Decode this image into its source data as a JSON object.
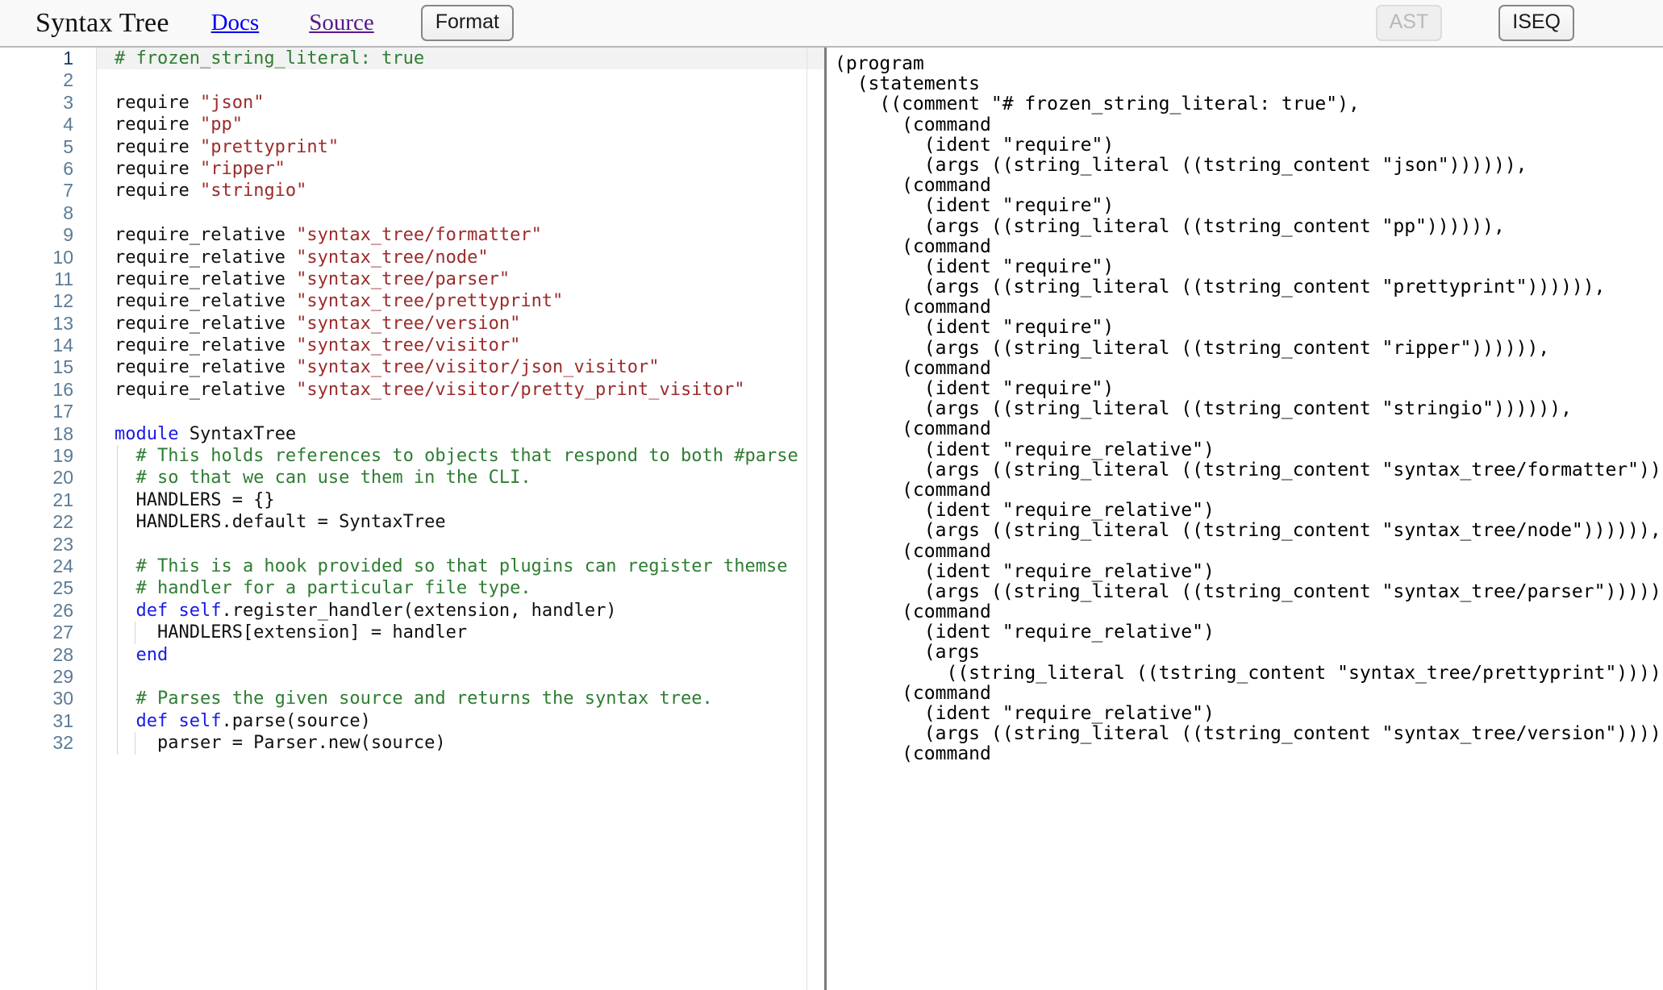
{
  "header": {
    "brand": "Syntax Tree",
    "docs_label": "Docs",
    "source_label": "Source",
    "format_label": "Format",
    "ast_label": "AST",
    "iseq_label": "ISEQ",
    "colors": {
      "link": "#0000ee",
      "visited_link": "#551a8b",
      "header_bg": "#f9f9f9",
      "button_border": "#868686",
      "disabled_text": "#b9b9b9"
    }
  },
  "editor": {
    "language": "ruby",
    "active_line": 1,
    "first_visible_line": 1,
    "last_visible_line": 32,
    "colors": {
      "comment": "#2e7d32",
      "string": "#9c2b2b",
      "keyword": "#1a1ae6",
      "text": "#111111",
      "line_number": "#5b7a95",
      "active_line_number": "#16385e",
      "active_line_bg": "#f2f2f2"
    },
    "lines": [
      {
        "n": 1,
        "indent": 0,
        "tokens": [
          {
            "t": "com",
            "v": "# frozen_string_literal: true"
          }
        ]
      },
      {
        "n": 2,
        "indent": 0,
        "tokens": []
      },
      {
        "n": 3,
        "indent": 0,
        "tokens": [
          {
            "t": "txt",
            "v": "require "
          },
          {
            "t": "str",
            "v": "\"json\""
          }
        ]
      },
      {
        "n": 4,
        "indent": 0,
        "tokens": [
          {
            "t": "txt",
            "v": "require "
          },
          {
            "t": "str",
            "v": "\"pp\""
          }
        ]
      },
      {
        "n": 5,
        "indent": 0,
        "tokens": [
          {
            "t": "txt",
            "v": "require "
          },
          {
            "t": "str",
            "v": "\"prettyprint\""
          }
        ]
      },
      {
        "n": 6,
        "indent": 0,
        "tokens": [
          {
            "t": "txt",
            "v": "require "
          },
          {
            "t": "str",
            "v": "\"ripper\""
          }
        ]
      },
      {
        "n": 7,
        "indent": 0,
        "tokens": [
          {
            "t": "txt",
            "v": "require "
          },
          {
            "t": "str",
            "v": "\"stringio\""
          }
        ]
      },
      {
        "n": 8,
        "indent": 0,
        "tokens": []
      },
      {
        "n": 9,
        "indent": 0,
        "tokens": [
          {
            "t": "txt",
            "v": "require_relative "
          },
          {
            "t": "str",
            "v": "\"syntax_tree/formatter\""
          }
        ]
      },
      {
        "n": 10,
        "indent": 0,
        "tokens": [
          {
            "t": "txt",
            "v": "require_relative "
          },
          {
            "t": "str",
            "v": "\"syntax_tree/node\""
          }
        ]
      },
      {
        "n": 11,
        "indent": 0,
        "tokens": [
          {
            "t": "txt",
            "v": "require_relative "
          },
          {
            "t": "str",
            "v": "\"syntax_tree/parser\""
          }
        ]
      },
      {
        "n": 12,
        "indent": 0,
        "tokens": [
          {
            "t": "txt",
            "v": "require_relative "
          },
          {
            "t": "str",
            "v": "\"syntax_tree/prettyprint\""
          }
        ]
      },
      {
        "n": 13,
        "indent": 0,
        "tokens": [
          {
            "t": "txt",
            "v": "require_relative "
          },
          {
            "t": "str",
            "v": "\"syntax_tree/version\""
          }
        ]
      },
      {
        "n": 14,
        "indent": 0,
        "tokens": [
          {
            "t": "txt",
            "v": "require_relative "
          },
          {
            "t": "str",
            "v": "\"syntax_tree/visitor\""
          }
        ]
      },
      {
        "n": 15,
        "indent": 0,
        "tokens": [
          {
            "t": "txt",
            "v": "require_relative "
          },
          {
            "t": "str",
            "v": "\"syntax_tree/visitor/json_visitor\""
          }
        ]
      },
      {
        "n": 16,
        "indent": 0,
        "tokens": [
          {
            "t": "txt",
            "v": "require_relative "
          },
          {
            "t": "str",
            "v": "\"syntax_tree/visitor/pretty_print_visitor\""
          }
        ]
      },
      {
        "n": 17,
        "indent": 0,
        "tokens": []
      },
      {
        "n": 18,
        "indent": 0,
        "tokens": [
          {
            "t": "kw",
            "v": "module"
          },
          {
            "t": "txt",
            "v": " SyntaxTree"
          }
        ]
      },
      {
        "n": 19,
        "indent": 1,
        "tokens": [
          {
            "t": "com",
            "v": "  # This holds references to objects that respond to both #parse"
          }
        ]
      },
      {
        "n": 20,
        "indent": 1,
        "tokens": [
          {
            "t": "com",
            "v": "  # so that we can use them in the CLI."
          }
        ]
      },
      {
        "n": 21,
        "indent": 1,
        "tokens": [
          {
            "t": "txt",
            "v": "  HANDLERS = {}"
          }
        ]
      },
      {
        "n": 22,
        "indent": 1,
        "tokens": [
          {
            "t": "txt",
            "v": "  HANDLERS.default = SyntaxTree"
          }
        ]
      },
      {
        "n": 23,
        "indent": 1,
        "tokens": []
      },
      {
        "n": 24,
        "indent": 1,
        "tokens": [
          {
            "t": "com",
            "v": "  # This is a hook provided so that plugins can register themse"
          }
        ]
      },
      {
        "n": 25,
        "indent": 1,
        "tokens": [
          {
            "t": "com",
            "v": "  # handler for a particular file type."
          }
        ]
      },
      {
        "n": 26,
        "indent": 1,
        "tokens": [
          {
            "t": "txt",
            "v": "  "
          },
          {
            "t": "kw",
            "v": "def"
          },
          {
            "t": "txt",
            "v": " "
          },
          {
            "t": "kw",
            "v": "self"
          },
          {
            "t": "txt",
            "v": ".register_handler(extension, handler)"
          }
        ]
      },
      {
        "n": 27,
        "indent": 2,
        "tokens": [
          {
            "t": "txt",
            "v": "    HANDLERS[extension] = handler"
          }
        ]
      },
      {
        "n": 28,
        "indent": 1,
        "tokens": [
          {
            "t": "txt",
            "v": "  "
          },
          {
            "t": "kw",
            "v": "end"
          }
        ]
      },
      {
        "n": 29,
        "indent": 1,
        "tokens": []
      },
      {
        "n": 30,
        "indent": 1,
        "tokens": [
          {
            "t": "com",
            "v": "  # Parses the given source and returns the syntax tree."
          }
        ]
      },
      {
        "n": 31,
        "indent": 1,
        "tokens": [
          {
            "t": "txt",
            "v": "  "
          },
          {
            "t": "kw",
            "v": "def"
          },
          {
            "t": "txt",
            "v": " "
          },
          {
            "t": "kw",
            "v": "self"
          },
          {
            "t": "txt",
            "v": ".parse(source)"
          }
        ]
      },
      {
        "n": 32,
        "indent": 2,
        "tokens": [
          {
            "t": "txt",
            "v": "    parser = Parser.new(source)"
          }
        ]
      }
    ]
  },
  "output": {
    "mode": "AST",
    "lines": [
      "(program",
      "  (statements",
      "    ((comment \"# frozen_string_literal: true\"),",
      "      (command",
      "        (ident \"require\")",
      "        (args ((string_literal ((tstring_content \"json\")))))),",
      "      (command",
      "        (ident \"require\")",
      "        (args ((string_literal ((tstring_content \"pp\")))))),",
      "      (command",
      "        (ident \"require\")",
      "        (args ((string_literal ((tstring_content \"prettyprint\")))))),",
      "      (command",
      "        (ident \"require\")",
      "        (args ((string_literal ((tstring_content \"ripper\")))))),",
      "      (command",
      "        (ident \"require\")",
      "        (args ((string_literal ((tstring_content \"stringio\")))))),",
      "      (command",
      "        (ident \"require_relative\")",
      "        (args ((string_literal ((tstring_content \"syntax_tree/formatter\")))))),",
      "      (command",
      "        (ident \"require_relative\")",
      "        (args ((string_literal ((tstring_content \"syntax_tree/node\")))))),",
      "      (command",
      "        (ident \"require_relative\")",
      "        (args ((string_literal ((tstring_content \"syntax_tree/parser\")))))),",
      "      (command",
      "        (ident \"require_relative\")",
      "        (args",
      "          ((string_literal ((tstring_content \"syntax_tree/prettyprint\")))))),",
      "      (command",
      "        (ident \"require_relative\")",
      "        (args ((string_literal ((tstring_content \"syntax_tree/version\")))))),",
      "      (command"
    ]
  }
}
